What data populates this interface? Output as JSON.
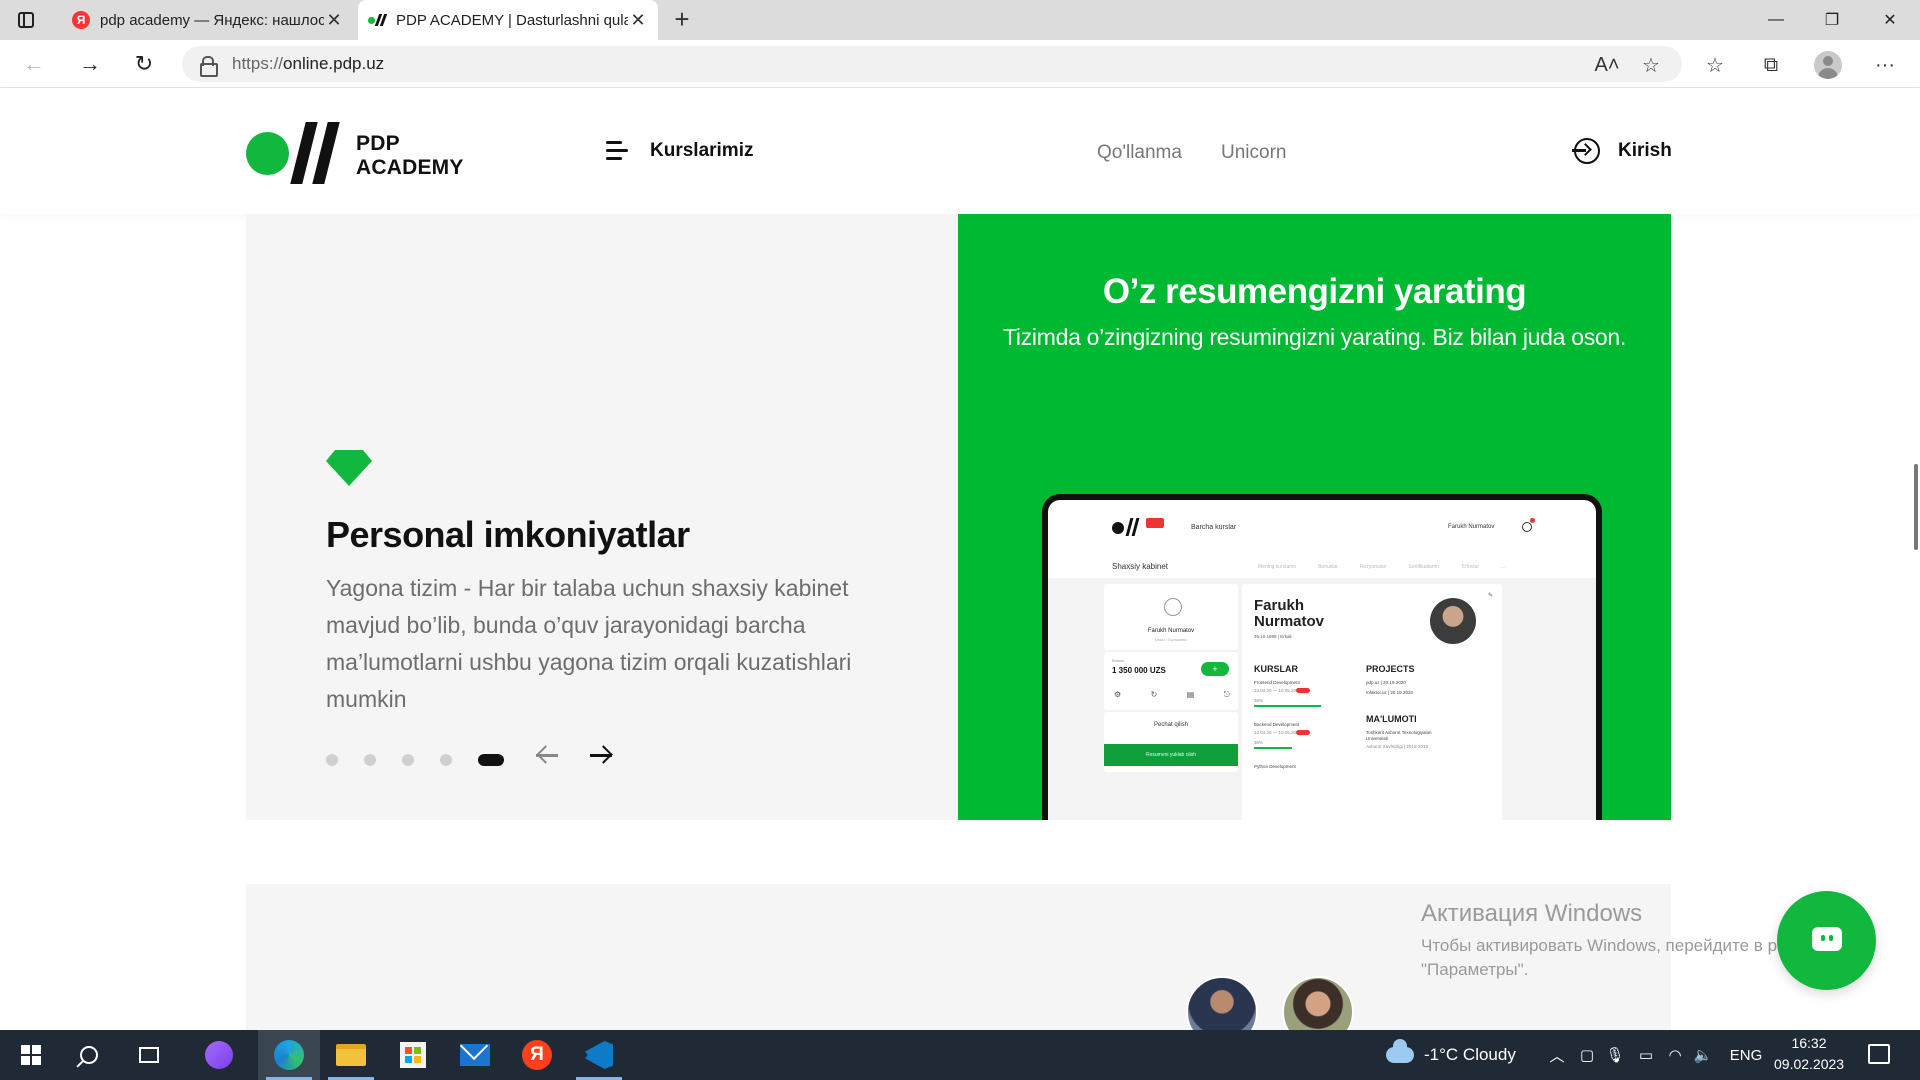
{
  "browser": {
    "tabs": [
      {
        "title": "pdp academy — Яндекс: нашлось",
        "favicon": "yandex-icon",
        "active": false
      },
      {
        "title": "PDP ACADEMY | Dasturlashni qulay",
        "favicon": "pdp-favicon-icon",
        "active": true
      }
    ],
    "new_tab_label": "+",
    "close_label": "✕",
    "window_controls": {
      "minimize": "—",
      "restore": "❐",
      "close": "✕"
    },
    "url": {
      "scheme": "https://",
      "host": "online.pdp.uz"
    },
    "nav": {
      "back": "←",
      "forward": "→",
      "reload": "↻"
    },
    "toolbar": {
      "read_aloud": "A˄",
      "add_favorite": "☆",
      "favorites": "☆",
      "collections": "⧉",
      "more": "···"
    }
  },
  "site": {
    "logo": {
      "line1": "PDP",
      "line2": "ACADEMY"
    },
    "menu_label": "Kurslarimiz",
    "links": [
      "Qo'llanma",
      "Unicorn"
    ],
    "login_label": "Kirish",
    "brand_color": "#12b83d"
  },
  "slide": {
    "icon": "diamond-icon",
    "title": "Personal imkoniyatlar",
    "text": "Yagona tizim - Har bir talaba uchun shaxsiy kabinet mavjud bo’lib, bunda o’quv jarayonidagi barcha ma’lumotlarni ushbu yagona tizim orqali kuzatishlari mumkin",
    "dots_count": 5,
    "active_dot": 5,
    "right_title": "O’z resumengizni yarating",
    "right_subtitle": "Tizimda o’zingizning resumingizni yarating. Biz bilan juda oson."
  },
  "mockup": {
    "menu": "Barcha kurslar",
    "user": "Farukh Nurmatov",
    "crumb": "Shaxsiy kabinet",
    "tabs": [
      "Mening kurslarim",
      "Bonuslar",
      "Rezyumalar",
      "Sertifikatlarim",
      "To'lovlar",
      "..."
    ],
    "profile_name": "Farukh Nurmatov",
    "profile_role": "Ustoz / Kurslariniz",
    "balance_label": "Balans",
    "balance": "1 350 000 UZS",
    "plus": "+",
    "pechat": "Pechat qilish",
    "resume_btn": "Resumeni yuklab olish",
    "big_name_1": "Farukh",
    "big_name_2": "Nurmatov",
    "dob": "25.10.1999  |  Erkak",
    "kurslar": "KURSLAR",
    "projects": "PROJECTS",
    "malumoti": "MA'LUMOTI",
    "course1": "Frontend Development",
    "course2": "Backend Development",
    "course3": "Python Development",
    "proj1": "pdp.uz  |  20.19.2020",
    "proj2": "mfaktor.uz  |  20.19.2020",
    "edu1": "Toshkent Axborot Texnologiyalari",
    "edu2": "Universiteti",
    "edu3": "Axborot Xavfsizligi  |  2015-2019",
    "date_range": "12.04.20 — 10.05.20",
    "percent": "36%",
    "progress": [
      0.7,
      0.4,
      0.85,
      0.55
    ]
  },
  "activation": {
    "title": "Активация Windows",
    "text": "Чтобы активировать Windows, перейдите в раздел \"Параметры\"."
  },
  "taskbar": {
    "weather": "-1°C  Cloudy",
    "lang": "ENG",
    "time": "16:32",
    "date": "09.02.2023",
    "apps": [
      "start-icon",
      "search-icon",
      "task-view-icon",
      "alice-icon",
      "edge-icon",
      "explorer-icon",
      "store-icon",
      "mail-icon",
      "yandex-browser-icon",
      "vscode-icon"
    ]
  }
}
